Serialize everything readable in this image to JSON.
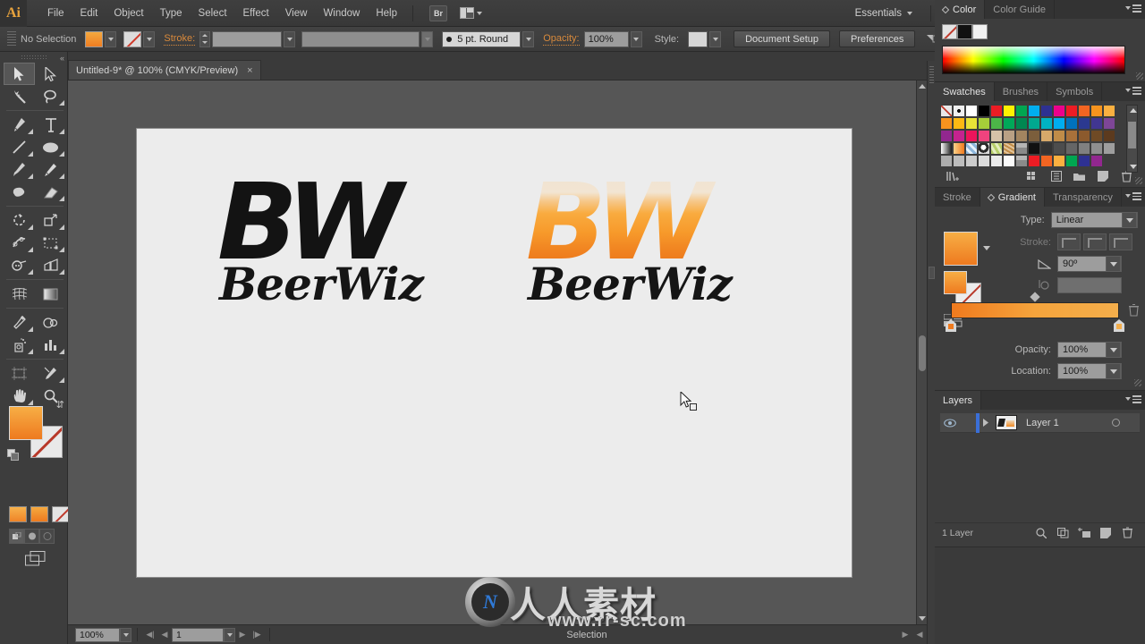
{
  "app": {
    "name": "Ai",
    "logo_label": "Ai"
  },
  "menubar": {
    "items": [
      "File",
      "Edit",
      "Object",
      "Type",
      "Select",
      "Effect",
      "View",
      "Window",
      "Help"
    ],
    "bridge_label": "Br",
    "workspace": "Essentials",
    "search_placeholder": "",
    "window_buttons": [
      "–",
      "□",
      "✕"
    ]
  },
  "controlbar": {
    "selection_status": "No Selection",
    "stroke_label": "Stroke:",
    "stroke_weight": "",
    "stroke_profile": "",
    "brush_definition": "5 pt. Round",
    "opacity_label": "Opacity:",
    "opacity_value": "100%",
    "style_label": "Style:",
    "document_setup": "Document Setup",
    "preferences": "Preferences"
  },
  "tabbar": {
    "document_title": "Untitled-9* @ 100% (CMYK/Preview)",
    "close": "×"
  },
  "toolbar": {
    "tools": [
      "selection-tool",
      "direct-selection-tool",
      "magic-wand-tool",
      "lasso-tool",
      "pen-tool",
      "type-tool",
      "line-segment-tool",
      "ellipse-tool",
      "paintbrush-tool",
      "pencil-tool",
      "blob-brush-tool",
      "eraser-tool",
      "rotate-tool",
      "scale-tool",
      "width-tool",
      "free-transform-tool",
      "shape-builder-tool",
      "perspective-grid-tool",
      "mesh-tool",
      "gradient-tool",
      "eyedropper-tool",
      "blend-tool",
      "symbol-sprayer-tool",
      "column-graph-tool",
      "artboard-tool",
      "slice-tool",
      "hand-tool",
      "zoom-tool"
    ],
    "active_tool": "selection-tool",
    "fill_color": "#f09030",
    "stroke_color": "none",
    "draw_modes": [
      "draw-normal",
      "draw-behind",
      "draw-inside"
    ]
  },
  "canvas": {
    "zoom": "100%",
    "logos": [
      {
        "id": "logo-black",
        "monogram": "BW",
        "wordmark": "BeerWiz",
        "style": "solid-black"
      },
      {
        "id": "logo-gradient",
        "monogram": "BW",
        "wordmark": "BeerWiz",
        "style": "beer-gradient"
      }
    ]
  },
  "statusbar": {
    "zoom": "100%",
    "page": "1",
    "status_text": "Selection"
  },
  "panels": {
    "color": {
      "tabs": [
        "Color",
        "Color Guide"
      ],
      "active_tab": "Color",
      "chips": [
        "none",
        "#111111",
        "#f2f2f2"
      ]
    },
    "swatches": {
      "tabs": [
        "Swatches",
        "Brushes",
        "Symbols"
      ],
      "active_tab": "Swatches",
      "rows": [
        [
          "none",
          "registration",
          "#ffffff",
          "#000000",
          "#ec1c24",
          "#fff200",
          "#00a651",
          "#00aeef",
          "#2e3192",
          "#ec008c",
          "#ed1c24",
          "#f26522",
          "#f7941e",
          "#fbb040"
        ],
        [
          "#f7941e",
          "#fdb913",
          "#e8e337",
          "#a6ce39",
          "#4cb648",
          "#00a859",
          "#008751",
          "#00a88f",
          "#00b3c3",
          "#00aeef",
          "#0072bc",
          "#2b3990",
          "#413691",
          "#7e4697"
        ],
        [
          "#92278f",
          "#c4238f",
          "#ed145b",
          "#f0437e",
          "#d6c2a8",
          "#b9a084",
          "#a38560",
          "#7b5e3c",
          "#d7a96a",
          "#c08c48",
          "#a9713a",
          "#8c5a2d",
          "#6f4a25",
          "#5c3a1e"
        ],
        [
          "gradient-white-black",
          "gradient-orange",
          "pattern-check",
          "pattern-globe",
          "pattern-leaf",
          "pattern-mosaic"
        ],
        [
          "folder",
          "#111111",
          "#333333",
          "#4d4d4d",
          "#666666",
          "#808080",
          "#8f8f8f",
          "#9e9e9e",
          "#adadad",
          "#bdbdbd",
          "#cccccc",
          "#dbdbdb",
          "#ebebeb",
          "#fafafa"
        ],
        [
          "folder",
          "#ed1c24",
          "#f26522",
          "#fbb040",
          "#00a651",
          "#2e3192",
          "#92278f"
        ]
      ]
    },
    "gradient": {
      "tabs": [
        "Stroke",
        "Gradient",
        "Transparency"
      ],
      "active_tab": "Gradient",
      "type_label": "Type:",
      "type_value": "Linear",
      "stroke_label": "Stroke:",
      "angle_value": "90º",
      "aspect_value": "",
      "opacity_label": "Opacity:",
      "opacity_value": "100%",
      "location_label": "Location:",
      "location_value": "100%",
      "stop_colors": [
        "#ef7a1e",
        "#f4ae4b"
      ],
      "midpoint_percent": 50
    },
    "layers": {
      "tabs": [
        "Layers"
      ],
      "active_tab": "Layers",
      "rows": [
        {
          "name": "Layer 1",
          "visible": true,
          "locked": false,
          "selected": true
        }
      ],
      "footer_count": "1 Layer"
    }
  },
  "watermark": {
    "mark": "N",
    "title": "人人素材",
    "url": "www.rr-sc.com"
  }
}
